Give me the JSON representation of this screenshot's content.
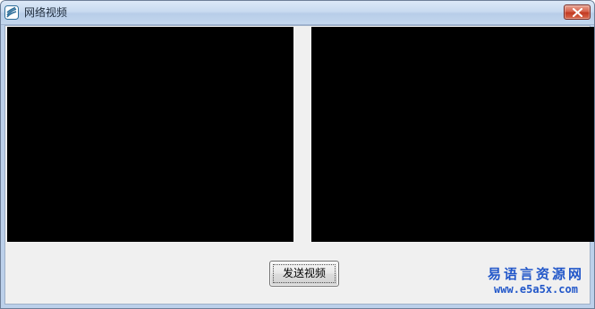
{
  "window": {
    "title": "网络视频",
    "icon": "app-logo-icon",
    "close_icon": "close-icon",
    "accent": "#c23a22"
  },
  "main": {
    "video_panes": [
      {
        "name": "local-video",
        "color": "#000000"
      },
      {
        "name": "remote-video",
        "color": "#000000"
      }
    ],
    "send_button_label": "发送视频"
  },
  "watermark": {
    "chinese": "易语言资源网",
    "url": "www.e5a5x.com",
    "color": "#2257c9"
  }
}
